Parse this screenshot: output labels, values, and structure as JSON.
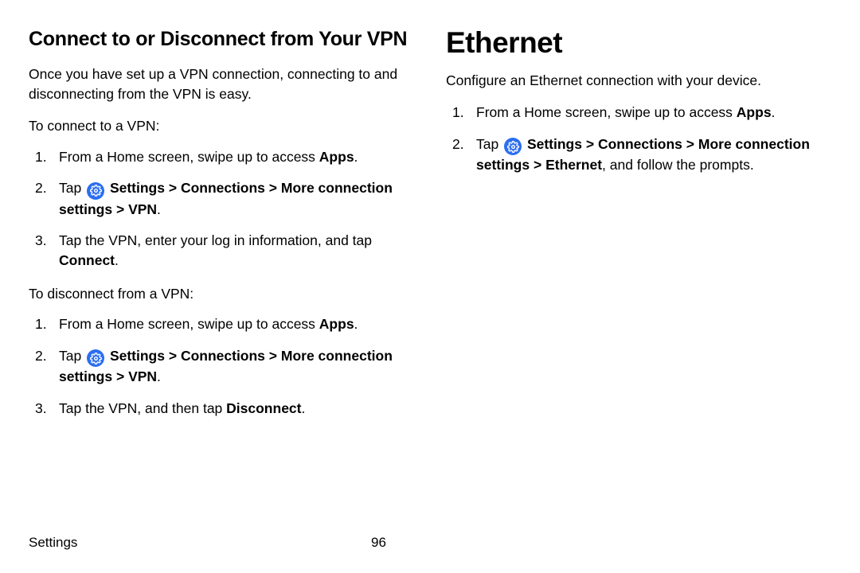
{
  "left": {
    "heading": "Connect to or Disconnect from Your VPN",
    "intro": "Once you have set up a VPN connection, connecting to and disconnecting from the VPN is easy.",
    "connect_label": "To connect to a VPN:",
    "connect_steps": {
      "s1_pre": "From a Home screen, swipe up to access ",
      "s1_bold": "Apps",
      "s1_post": ".",
      "s2_pre": "Tap ",
      "s2_bold1": " Settings",
      "s2_sep1": " > ",
      "s2_bold2": "Connections",
      "s2_sep2": " > ",
      "s2_bold3": "More connection settings",
      "s2_sep3": " > ",
      "s2_bold4": "VPN",
      "s2_post": ".",
      "s3_pre": "Tap the VPN, enter your log in information, and tap ",
      "s3_bold": "Connect",
      "s3_post": "."
    },
    "disconnect_label": "To disconnect from a VPN:",
    "disconnect_steps": {
      "s1_pre": "From a Home screen, swipe up to access ",
      "s1_bold": "Apps",
      "s1_post": ".",
      "s2_pre": "Tap ",
      "s2_bold1": " Settings",
      "s2_sep1": " > ",
      "s2_bold2": "Connections",
      "s2_sep2": " > ",
      "s2_bold3": "More connection settings",
      "s2_sep3": " > ",
      "s2_bold4": "VPN",
      "s2_post": ".",
      "s3_pre": "Tap the VPN, and then tap ",
      "s3_bold": "Disconnect",
      "s3_post": "."
    }
  },
  "right": {
    "heading": "Ethernet",
    "intro": "Configure an Ethernet connection with your device.",
    "steps": {
      "s1_pre": "From a Home screen, swipe up to access ",
      "s1_bold": "Apps",
      "s1_post": ".",
      "s2_pre": "Tap ",
      "s2_bold1": " Settings",
      "s2_sep1": " > ",
      "s2_bold2": "Connections",
      "s2_sep2": " > ",
      "s2_bold3": "More connection settings",
      "s2_sep3": " > ",
      "s2_bold4": "Ethernet",
      "s2_post": ", and follow the prompts."
    }
  },
  "footer": {
    "section": "Settings",
    "page": "96"
  }
}
